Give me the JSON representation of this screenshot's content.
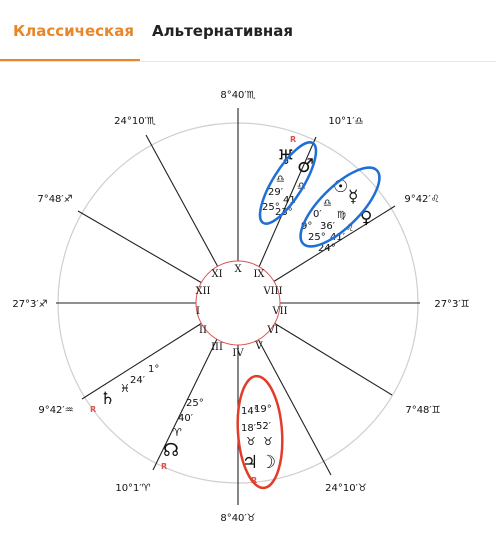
{
  "tabs": {
    "classic": "Классическая",
    "alternative": "Альтернативная"
  },
  "colors": {
    "accent": "#e8862a",
    "blue_mark": "#1f6fd6",
    "red_mark": "#e23c2b",
    "house_ring": "#d9534f",
    "retro": "#d9534f"
  },
  "chart": {
    "cusps": [
      "8°40′♏",
      "10°1′♎",
      "9°42′♌",
      "27°3′♊",
      "7°48′♊",
      "24°10′♉",
      "8°40′♉",
      "10°1′♈",
      "9°42′♒",
      "27°3′♐",
      "7°48′♐",
      "24°10′♏"
    ],
    "houses": [
      "X",
      "IX",
      "VIII",
      "VII",
      "VI",
      "V",
      "IV",
      "III",
      "II",
      "I",
      "XII",
      "XI"
    ],
    "retro_mark": "R",
    "planets_a": {
      "glyph1": "♅",
      "glyph2": "♂",
      "sign1": "♎",
      "sign2": "♎",
      "deg1": "29′",
      "deg2": "41′",
      "deg3": "25°",
      "deg4": "23°"
    },
    "planets_b": {
      "glyph1": "☉",
      "glyph2": "☿",
      "glyph3": "♀",
      "sign1": "♎",
      "sign2": "♍",
      "sign3": "♌",
      "deg1": "0′",
      "deg2": "9°",
      "deg3": "36′",
      "deg4": "25°",
      "deg5": "41′",
      "deg6": "24°"
    },
    "saturn": {
      "glyph": "♄",
      "sign": "♓",
      "deg1": "24′",
      "deg2": "1°"
    },
    "node": {
      "glyph": "☊",
      "sign": "♈",
      "deg1": "40′",
      "deg2": "25°"
    },
    "jupiter_moon": {
      "deg1": "14°",
      "deg2": "19°",
      "deg3": "18′",
      "deg4": "52′",
      "sign1": "♉",
      "sign2": "♉",
      "glyph1": "♃",
      "glyph2": "☽"
    }
  }
}
